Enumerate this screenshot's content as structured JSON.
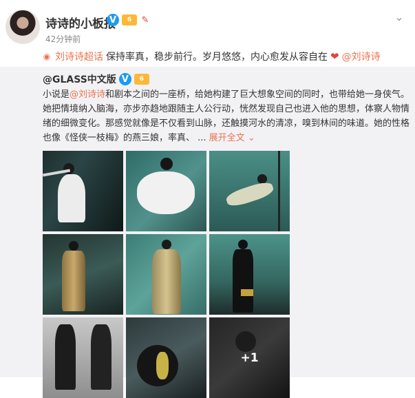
{
  "post": {
    "username": "诗诗的小板报",
    "timestamp": "42分钟前",
    "verified_mark": "V",
    "level_badge": "6",
    "topic_tag": "刘诗诗超话",
    "content": "保持率真，稳步前行。岁月悠悠，内心愈发从容自在",
    "mention": "@刘诗诗"
  },
  "repost": {
    "origin_account": "@GLASS中文版",
    "verified_mark": "V",
    "level_badge": "6",
    "text_1": "小说是",
    "mention": "@刘诗诗",
    "text_2": "和剧本之间的一座桥，给她构建了巨大想象空间的同时，也带给她一身侠气。她把情境纳入脑海，亦步亦趋地跟随主人公行动，恍然发现自己也进入他的思想，体察人物情绪的细微变化。那感觉就像是不仅看到山脉，还触摸河水的清凉，嗅到林间的味道。她的性格也像《怪侠一枝梅》的燕三娘，率真、 ... ",
    "expand_label": "展开全文",
    "more_count": "+1"
  },
  "icons": {
    "chevron": "chevron-down-icon",
    "topic": "eye-icon",
    "heart": "heart-icon",
    "expand": "chevron-down-icon"
  },
  "colors": {
    "accent": "#eb7350",
    "verified": "#1d9bf0",
    "repost_bg": "#f2f2f5"
  }
}
